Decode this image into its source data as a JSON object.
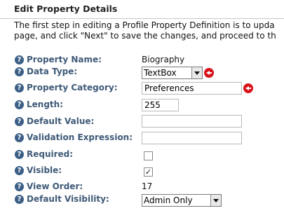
{
  "header": {
    "title": "Edit Property Details"
  },
  "intro": {
    "line1": "The first step in editing a Profile Property Definition is to upda",
    "line2": "page, and click \"Next\" to save the changes, and proceed to th"
  },
  "form": {
    "property_name": {
      "label": "Property Name:",
      "value": "Biography"
    },
    "data_type": {
      "label": "Data Type:",
      "value": "TextBox"
    },
    "property_category": {
      "label": "Property Category:",
      "value": "Preferences"
    },
    "length": {
      "label": "Length:",
      "value": "255"
    },
    "default_value": {
      "label": "Default Value:",
      "value": ""
    },
    "validation_expression": {
      "label": "Validation Expression:",
      "value": ""
    },
    "required": {
      "label": "Required:",
      "checked": false
    },
    "visible": {
      "label": "Visible:",
      "checked": true,
      "check_glyph": "✓"
    },
    "view_order": {
      "label": "View Order:",
      "value": "17"
    },
    "default_visibility": {
      "label": "Default Visibility:",
      "value": "Admin Only"
    }
  },
  "icons": {
    "help": "?",
    "help_color": "#3b5f86",
    "required_color": "#d8131b"
  }
}
